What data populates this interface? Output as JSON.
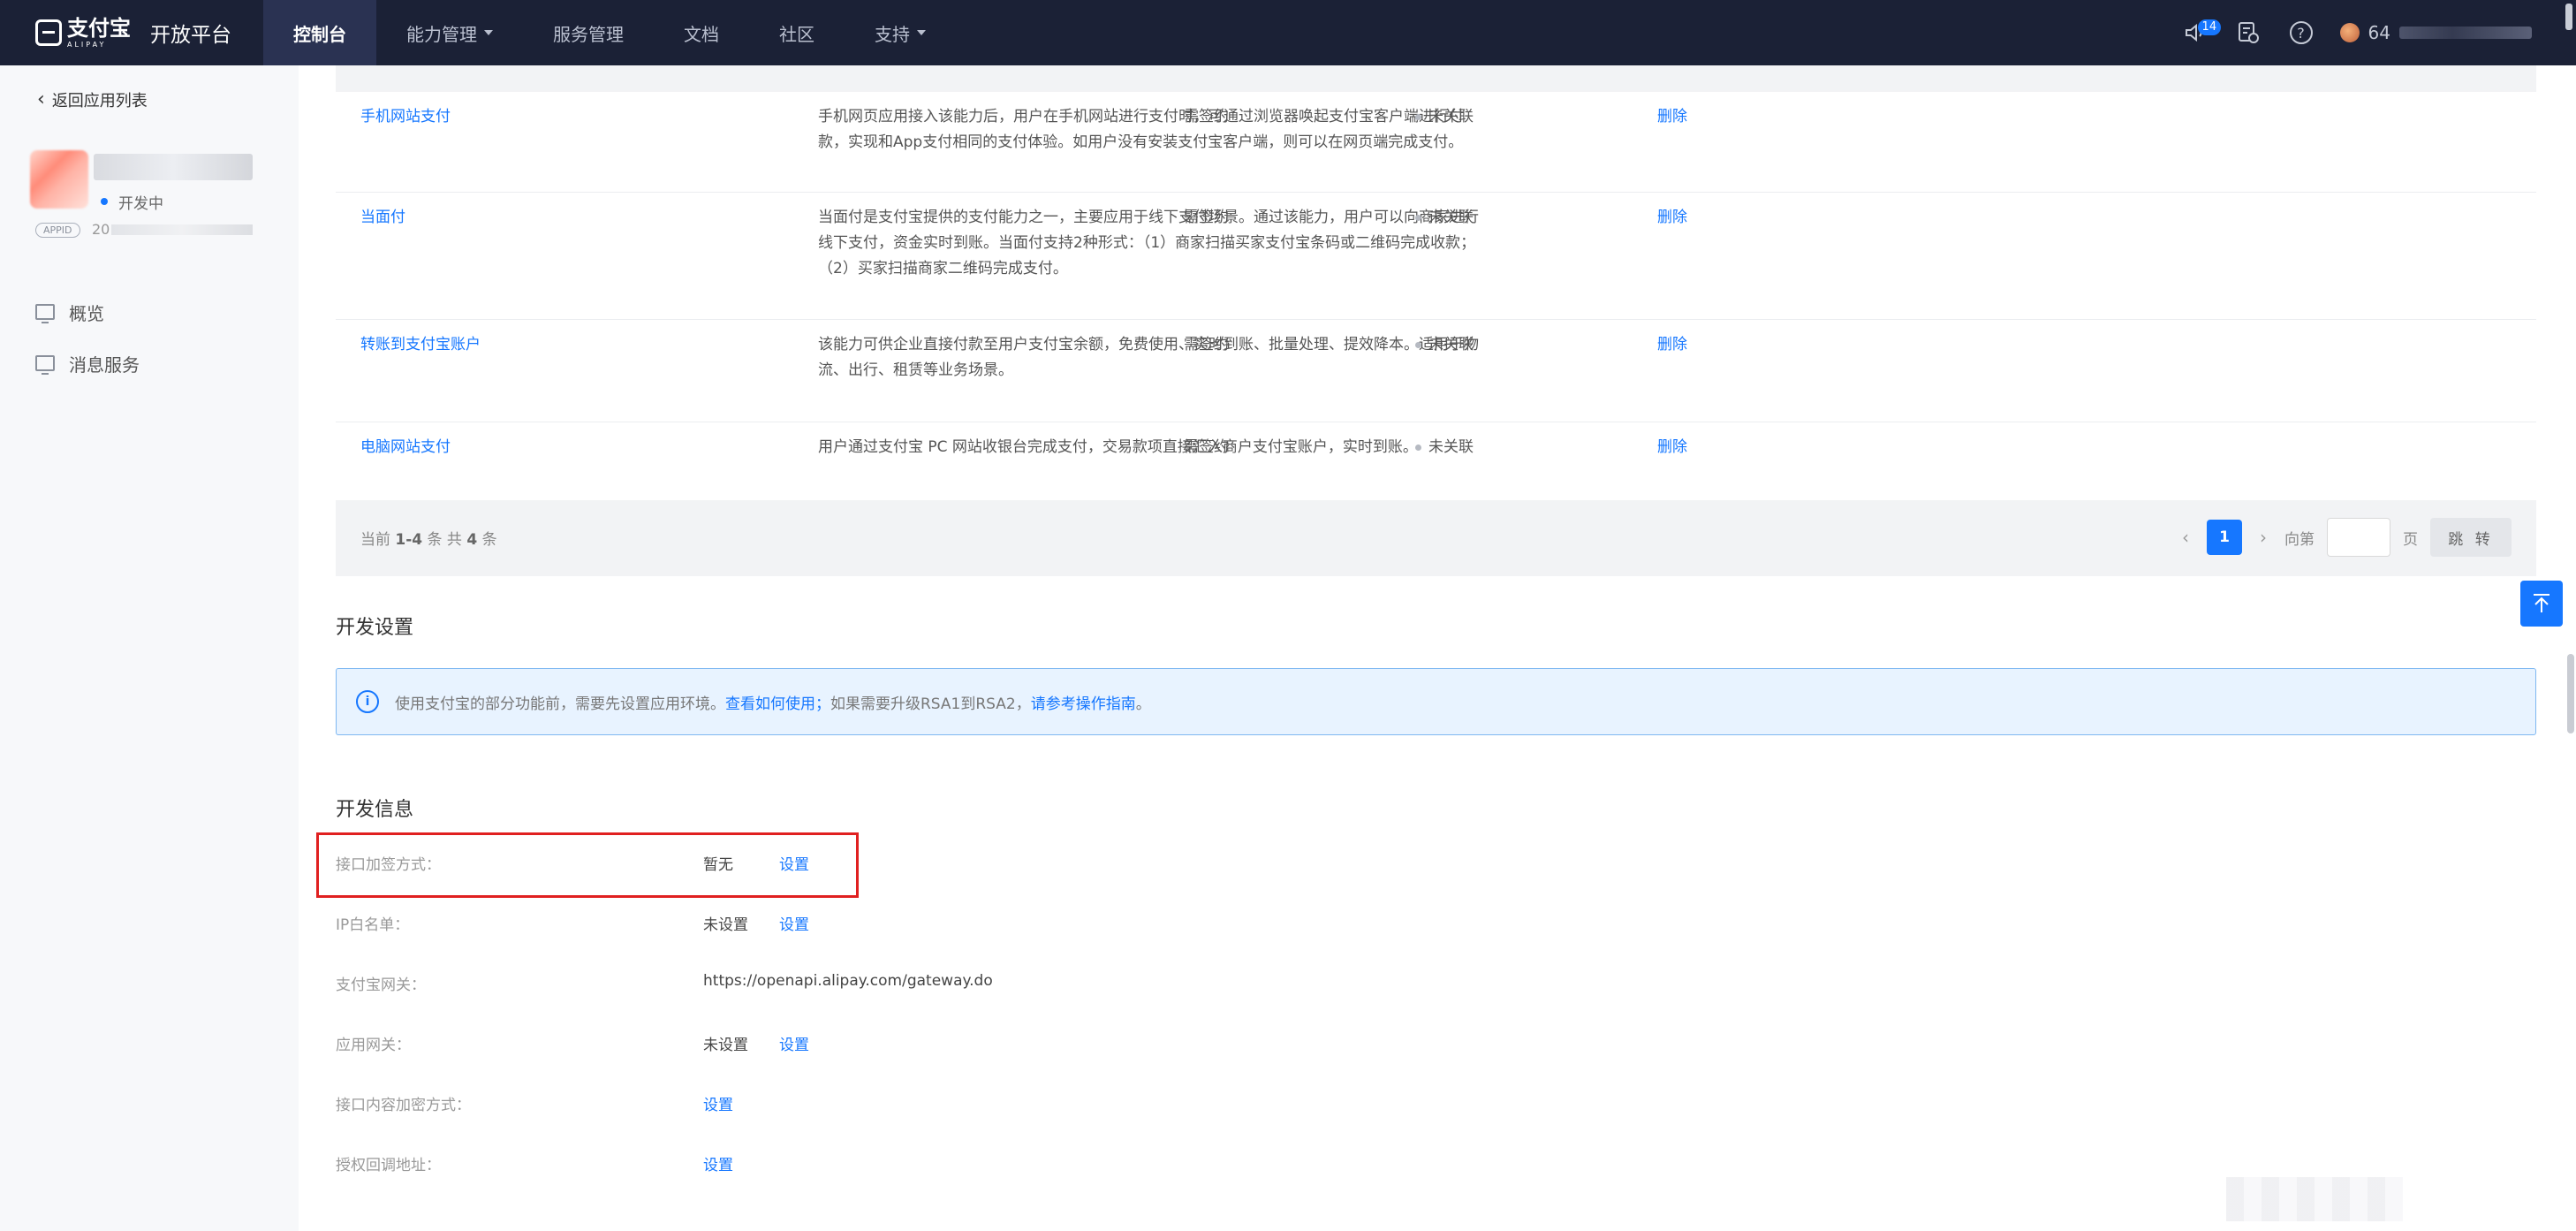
{
  "brand": {
    "cn": "支付宝",
    "en": "ALIPAY",
    "platform": "开放平台"
  },
  "nav": [
    {
      "label": "控制台",
      "active": true,
      "dropdown": false
    },
    {
      "label": "能力管理",
      "active": false,
      "dropdown": true
    },
    {
      "label": "服务管理",
      "active": false,
      "dropdown": false
    },
    {
      "label": "文档",
      "active": false,
      "dropdown": false
    },
    {
      "label": "社区",
      "active": false,
      "dropdown": false
    },
    {
      "label": "支持",
      "active": false,
      "dropdown": true
    }
  ],
  "topbar_right": {
    "notification_count": "14",
    "user_prefix": "64"
  },
  "sidebar": {
    "back_label": "返回应用列表",
    "app_status": "开发中",
    "appid_tag": "APPID",
    "appid_prefix": "20",
    "menu": [
      {
        "label": "概览",
        "icon": "monitor-icon"
      },
      {
        "label": "消息服务",
        "icon": "chart-monitor-icon"
      }
    ]
  },
  "capabilities": {
    "rows": [
      {
        "name": "手机网站支付",
        "desc": "手机网页应用接入该能力后，用户在手机网站进行支付时，可通过浏览器唤起支付宝客户端进行付款，实现和App支付相同的支付体验。如用户没有安装支付宝客户端，则可以在网页端完成支付。",
        "sign": "需签约",
        "status": "未关联",
        "op": "删除"
      },
      {
        "name": "当面付",
        "desc": "当面付是支付宝提供的支付能力之一，主要应用于线下支付场景。通过该能力，用户可以向商家进行线下支付，资金实时到账。当面付支持2种形式：（1）商家扫描买家支付宝条码或二维码完成收款；（2）买家扫描商家二维码完成支付。",
        "sign": "需签约",
        "status": "未关联",
        "op": "删除"
      },
      {
        "name": "转账到支付宝账户",
        "desc": "该能力可供企业直接付款至用户支付宝余额，免费使用、实时到账、批量处理、提效降本。适用于物流、出行、租赁等业务场景。",
        "sign": "需签约",
        "status": "未关联",
        "op": "删除"
      },
      {
        "name": "电脑网站支付",
        "desc": "用户通过支付宝 PC 网站收银台完成支付，交易款项直接汇入商户支付宝账户，实时到账。",
        "sign": "需签约",
        "status": "未关联",
        "op": "删除"
      }
    ],
    "pager": {
      "info_pre": "当前",
      "range": "1-4",
      "info_mid": "条 共",
      "total": "4",
      "info_post": "条",
      "current_page": "1",
      "goto_label": "向第",
      "page_unit": "页",
      "jump_button": "跳 转"
    }
  },
  "dev_settings": {
    "title": "开发设置",
    "notice_text": "使用支付宝的部分功能前，需要先设置应用环境。",
    "notice_link1": "查看如何使用；",
    "notice_mid": "如果需要升级RSA1到RSA2，",
    "notice_link2": "请参考操作指南",
    "notice_end": "。"
  },
  "dev_info": {
    "title": "开发信息",
    "rows": [
      {
        "label": "接口加签方式：",
        "value": "暂无",
        "link": "设置"
      },
      {
        "label": "IP白名单：",
        "value": "未设置",
        "link": "设置"
      },
      {
        "label": "支付宝网关：",
        "value": "https://openapi.alipay.com/gateway.do",
        "link": ""
      },
      {
        "label": "应用网关：",
        "value": "未设置",
        "link": "设置"
      },
      {
        "label": "接口内容加密方式：",
        "value": "",
        "link": "设置"
      },
      {
        "label": "授权回调地址：",
        "value": "",
        "link": "设置"
      }
    ]
  },
  "colors": {
    "nav_bg": "#1b2136",
    "accent": "#1677ff",
    "highlight": "#e02020"
  }
}
